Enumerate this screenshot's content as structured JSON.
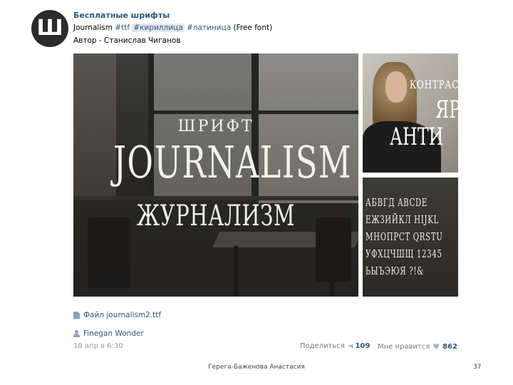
{
  "post": {
    "avatar_letter": "Ш",
    "group_name": "Бесплатные шрифты",
    "text_prefix": "Journalism",
    "tags": [
      "#ttf",
      "#кириллица",
      "#латиница"
    ],
    "text_suffix": "(Free font)",
    "author_line": "Автор - Станислав Чиганов"
  },
  "images": {
    "main": {
      "line1": "ШРИФТ",
      "line2": "JOURNALISM",
      "line3": "ЖУРНАЛИЗМ"
    },
    "top_right": {
      "line1": "КОНТРАС",
      "line2": "ЯР",
      "line3": "АНТИ"
    },
    "bottom_right": {
      "lines": [
        "АБВГД ABCDE",
        "ЕЖЗИЙКЛ HIJKL",
        "МНОПРСТ QRSTU",
        "УФХЦЧШЩ 12345",
        "ЬЫЪЭЮЯ ?!&"
      ]
    }
  },
  "attachment": {
    "file_label": "Файл journalism2.ttf",
    "icon": "file-icon"
  },
  "signer": {
    "name": "Finegan Wonder",
    "icon": "person-icon"
  },
  "meta": {
    "date": "18 апр в 6:30",
    "share_label": "Поделиться",
    "share_count": "109",
    "like_label": "Мне нравится",
    "like_count": "862"
  },
  "footer": {
    "name": "Герега-Баженова Анастасия",
    "page": "37"
  },
  "colors": {
    "link": "#2b587a",
    "meta": "#999999",
    "avatar_bg": "#2b2b2b"
  }
}
